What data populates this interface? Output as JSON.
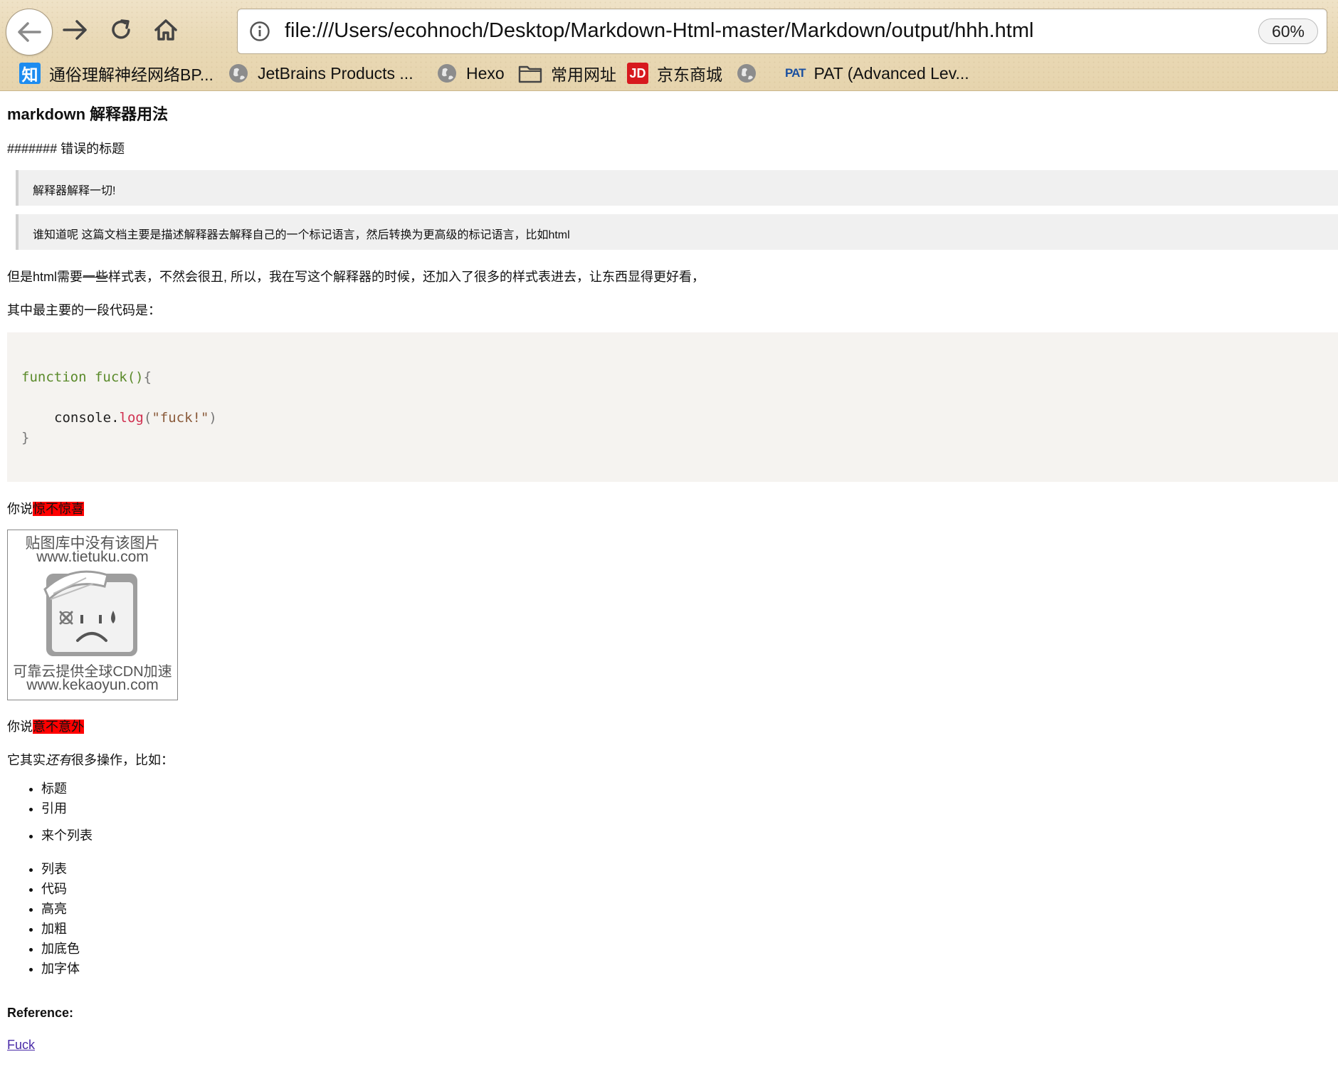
{
  "browser": {
    "url": "file:///Users/ecohnoch/Desktop/Markdown-Html-master/Markdown/output/hhh.html",
    "zoom": "60%",
    "bookmarks": [
      {
        "label": "通俗理解神经网络BP...",
        "icon": "zhihu-icon"
      },
      {
        "label": "JetBrains Products ...",
        "icon": "globe-icon"
      },
      {
        "label": "Hexo",
        "icon": "globe-icon"
      },
      {
        "label": "常用网址",
        "icon": "folder-icon"
      },
      {
        "label": "京东商城",
        "icon": "jd-icon"
      },
      {
        "label": "",
        "icon": "globe-icon"
      },
      {
        "label": "PAT (Advanced Lev...",
        "icon": "pat-icon"
      }
    ],
    "zhihu_glyph": "知",
    "jd_glyph": "JD",
    "pat_glyph": "PAT"
  },
  "doc": {
    "title": "markdown 解释器用法",
    "wrong_heading": "####### 错误的标题",
    "quote1": "解释器解释一切!",
    "quote2": "谁知道呢 这篇文档主要是描述解释器去解释自己的一个标记语言，然后转换为更高级的标记语言，比如html",
    "para1_a": "但是html需要",
    "para1_strike": "一些",
    "para1_b": "样式表，不然会很丑, 所以，我在写这个解释器的时候，还加入了很多的样式表进去，让东西显得更好看，",
    "para2": "其中最主要的一段代码是：",
    "code": {
      "kw": "function",
      "fn": "fuck",
      "parens": "()",
      "brace_open": "{",
      "obj": "console",
      "dot": ".",
      "meth": "log",
      "paren_open": "(",
      "str": "\"fuck!\"",
      "paren_close": ")",
      "brace_close": "}"
    },
    "say1_prefix": "你说",
    "say1_hl": "惊不惊喜",
    "image": {
      "line1": "贴图库中没有该图片",
      "line2": "www.tietuku.com",
      "line3": "可靠云提供全球CDN加速",
      "line4": "www.kekaoyun.com"
    },
    "say2_prefix": "你说",
    "say2_hl": "意不意外",
    "more_a": "它其实",
    "more_em": "还有",
    "more_b": "很多操作，比如：",
    "list1": [
      "标题",
      "引用"
    ],
    "list2": [
      "来个列表"
    ],
    "list3": [
      "列表",
      "代码",
      "高亮",
      "加粗",
      "加底色",
      "加字体"
    ],
    "reference_label": "Reference:",
    "reference_link": "Fuck"
  }
}
